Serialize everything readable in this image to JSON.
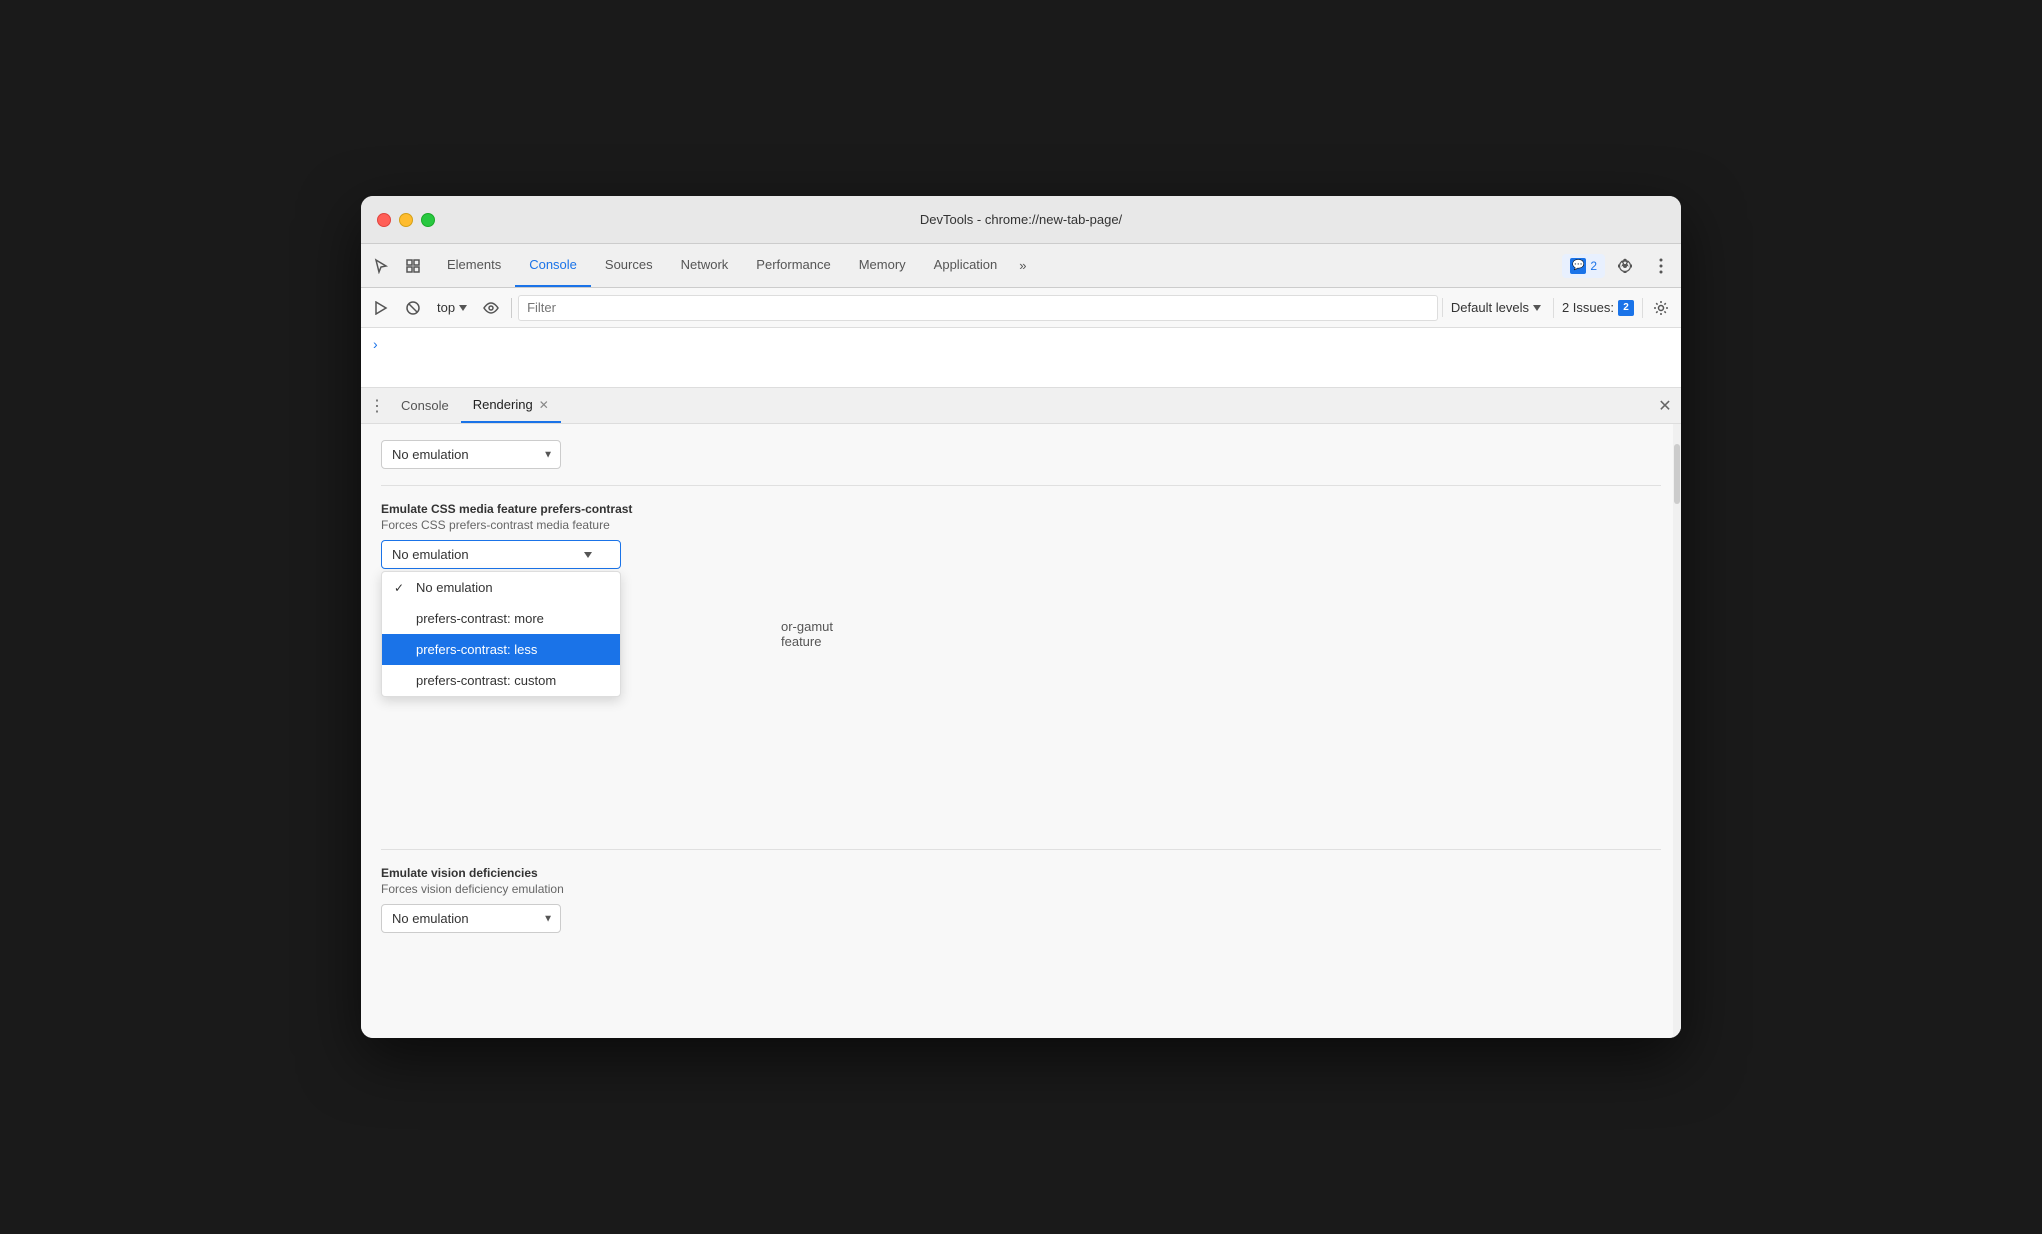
{
  "window": {
    "title": "DevTools - chrome://new-tab-page/"
  },
  "tabs": [
    {
      "id": "elements",
      "label": "Elements",
      "active": false
    },
    {
      "id": "console",
      "label": "Console",
      "active": true
    },
    {
      "id": "sources",
      "label": "Sources",
      "active": false
    },
    {
      "id": "network",
      "label": "Network",
      "active": false
    },
    {
      "id": "performance",
      "label": "Performance",
      "active": false
    },
    {
      "id": "memory",
      "label": "Memory",
      "active": false
    },
    {
      "id": "application",
      "label": "Application",
      "active": false
    }
  ],
  "tabs_overflow": "»",
  "issues_badge": {
    "icon": "💬",
    "count": "2"
  },
  "console_toolbar": {
    "filter_placeholder": "Filter",
    "context_label": "top",
    "default_levels_label": "Default levels",
    "issues_count_label": "2 Issues:",
    "issues_count_num": "2"
  },
  "panel_tabs": [
    {
      "id": "console-tab",
      "label": "Console",
      "active": false,
      "closeable": false
    },
    {
      "id": "rendering-tab",
      "label": "Rendering",
      "active": true,
      "closeable": true
    }
  ],
  "rendering": {
    "contrast_section": {
      "title": "Emulate CSS media feature prefers-contrast",
      "description": "Forces CSS prefers-contrast media feature",
      "current_value": "No emulation",
      "dropdown_options": [
        {
          "id": "no-emulation",
          "label": "No emulation",
          "checked": true,
          "selected": false
        },
        {
          "id": "more",
          "label": "prefers-contrast: more",
          "checked": false,
          "selected": false
        },
        {
          "id": "less",
          "label": "prefers-contrast: less",
          "checked": false,
          "selected": true
        },
        {
          "id": "custom",
          "label": "prefers-contrast: custom",
          "checked": false,
          "selected": false
        }
      ]
    },
    "color_gamut_partial_label": "or-gamut",
    "color_gamut_partial_desc": "feature",
    "vision_section": {
      "title": "Emulate vision deficiencies",
      "description": "Forces vision deficiency emulation",
      "current_value": "No emulation"
    },
    "above_dropdown_value": "No emulation"
  }
}
